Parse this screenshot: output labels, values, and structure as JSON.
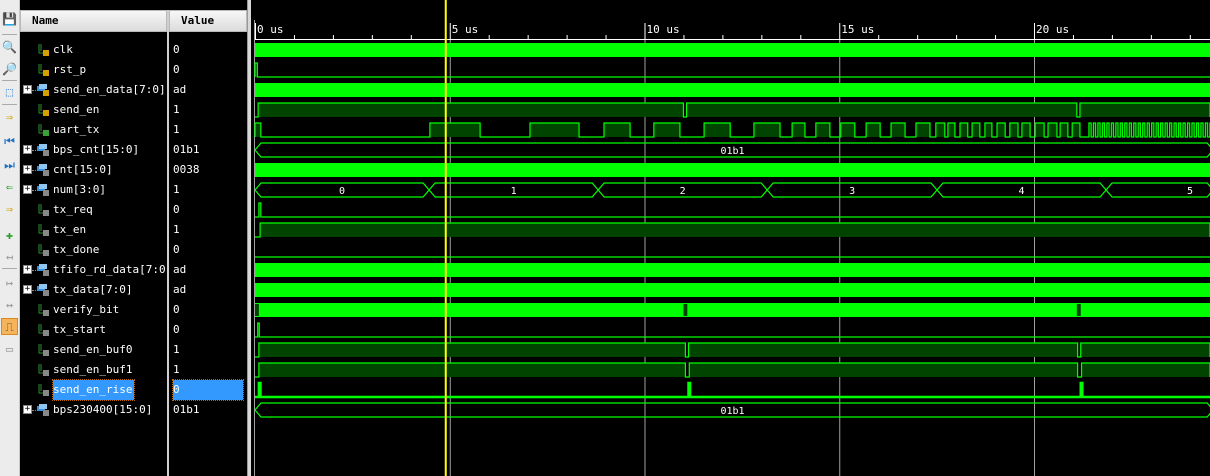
{
  "toolbar": {
    "buttons": [
      {
        "name": "save-icon",
        "glyph": "💾"
      },
      {
        "name": "zoom-in-icon",
        "glyph": "🔍"
      },
      {
        "name": "zoom-out-icon",
        "glyph": "🔎"
      },
      {
        "name": "zoom-fit-icon",
        "glyph": "⬚"
      },
      {
        "name": "goto-cursor-icon",
        "glyph": "⇒"
      },
      {
        "name": "go-to-start-icon",
        "glyph": "⏮"
      },
      {
        "name": "go-to-end-icon",
        "glyph": "⏭"
      },
      {
        "name": "previous-transition-icon",
        "glyph": "⇐"
      },
      {
        "name": "next-transition-icon",
        "glyph": "⇒"
      },
      {
        "name": "add-marker-icon",
        "glyph": "✚"
      },
      {
        "name": "previous-marker-icon",
        "glyph": "↤"
      },
      {
        "name": "next-marker-icon",
        "glyph": "↦"
      },
      {
        "name": "swap-cursors-icon",
        "glyph": "↔"
      },
      {
        "name": "snap-to-transition-icon",
        "glyph": "⎍"
      },
      {
        "name": "ruler-icon",
        "glyph": "▭"
      }
    ]
  },
  "headers": {
    "name": "Name",
    "value": "Value"
  },
  "colors": {
    "wave": "#00ff00",
    "fill": "#004400",
    "cursor": "#ffff00",
    "grid": "#a0a0a0",
    "selection": "#3399ff"
  },
  "timeline": {
    "unit": "us",
    "max_us": 24.6,
    "labels": [
      "0 us",
      "5 us",
      "10 us",
      "15 us",
      "20 us"
    ],
    "label_times": [
      0,
      5,
      10,
      15,
      20
    ],
    "cursor_us": 5.0
  },
  "signals": [
    {
      "name": "clk",
      "value": "0",
      "bus": false,
      "kind": "input",
      "wave": {
        "type": "dense"
      }
    },
    {
      "name": "rst_p",
      "value": "0",
      "bus": false,
      "kind": "input",
      "wave": {
        "type": "bit",
        "high": [
          [
            0,
            0.06
          ]
        ]
      }
    },
    {
      "name": "send_en_data[7:0]",
      "value": "ad",
      "bus": true,
      "kind": "input",
      "wave": {
        "type": "dense"
      }
    },
    {
      "name": "send_en",
      "value": "1",
      "bus": false,
      "kind": "input",
      "wave": {
        "type": "bit",
        "high": [
          [
            0.08,
            11.0
          ],
          [
            11.08,
            21.1
          ],
          [
            21.18,
            24.6
          ]
        ]
      }
    },
    {
      "name": "uart_tx",
      "value": "1",
      "bus": false,
      "kind": "output",
      "wave": {
        "type": "bit",
        "high": [
          [
            0,
            0.15
          ],
          [
            4.49,
            5.78
          ],
          [
            7.06,
            8.32
          ],
          [
            8.96,
            9.63
          ],
          [
            10.24,
            10.91
          ],
          [
            11.53,
            12.2
          ],
          [
            12.81,
            13.48
          ],
          [
            13.79,
            14.12
          ],
          [
            14.4,
            14.76
          ],
          [
            15.04,
            15.4
          ],
          [
            15.69,
            16.05
          ],
          [
            16.33,
            16.69
          ],
          [
            16.97,
            17.33
          ],
          [
            17.48,
            17.71
          ],
          [
            17.79,
            17.97
          ],
          [
            18.1,
            18.3
          ],
          [
            18.41,
            18.61
          ],
          [
            18.74,
            18.92
          ],
          [
            19.05,
            19.26
          ],
          [
            19.38,
            19.59
          ],
          [
            19.69,
            19.9
          ],
          [
            20.03,
            20.26
          ],
          [
            20.36,
            20.59
          ],
          [
            20.67,
            20.87
          ],
          [
            20.98,
            21.18
          ]
        ],
        "toggle_from": 21.41,
        "toggle_period": 0.115
      }
    },
    {
      "name": "bps_cnt[15:0]",
      "value": "01b1",
      "bus": true,
      "kind": "internal",
      "wave": {
        "type": "bus",
        "segments": [
          {
            "from": 0,
            "to": 24.6,
            "label": "01b1"
          }
        ]
      }
    },
    {
      "name": "cnt[15:0]",
      "value": "0038",
      "bus": true,
      "kind": "internal",
      "wave": {
        "type": "dense"
      }
    },
    {
      "name": "num[3:0]",
      "value": "1",
      "bus": true,
      "kind": "internal",
      "wave": {
        "type": "bus",
        "segments": [
          {
            "from": 0,
            "to": 4.47,
            "label": "0"
          },
          {
            "from": 4.47,
            "to": 8.81,
            "label": "1"
          },
          {
            "from": 8.81,
            "to": 13.15,
            "label": "2"
          },
          {
            "from": 13.15,
            "to": 17.51,
            "label": "3"
          },
          {
            "from": 17.51,
            "to": 21.85,
            "label": "4"
          },
          {
            "from": 21.85,
            "to": 24.6,
            "label": "5"
          }
        ]
      }
    },
    {
      "name": "tx_req",
      "value": "0",
      "bus": false,
      "kind": "internal",
      "wave": {
        "type": "bit",
        "high": [
          [
            0.1,
            0.15
          ]
        ]
      }
    },
    {
      "name": "tx_en",
      "value": "1",
      "bus": false,
      "kind": "internal",
      "wave": {
        "type": "bit",
        "high": [
          [
            0.13,
            24.6
          ]
        ]
      }
    },
    {
      "name": "tx_done",
      "value": "0",
      "bus": false,
      "kind": "internal",
      "wave": {
        "type": "bit",
        "high": []
      }
    },
    {
      "name": "tfifo_rd_data[7:0]",
      "value": "ad",
      "bus": true,
      "kind": "internal",
      "wave": {
        "type": "dense"
      }
    },
    {
      "name": "tx_data[7:0]",
      "value": "ad",
      "bus": true,
      "kind": "internal",
      "wave": {
        "type": "dense"
      }
    },
    {
      "name": "verify_bit",
      "value": "0",
      "bus": false,
      "kind": "internal",
      "wave": {
        "type": "dense",
        "gaps": [
          [
            0,
            0.1
          ],
          [
            11.0,
            11.1
          ],
          [
            21.1,
            21.2
          ]
        ]
      }
    },
    {
      "name": "tx_start",
      "value": "0",
      "bus": false,
      "kind": "internal",
      "wave": {
        "type": "bit",
        "high": [
          [
            0.07,
            0.11
          ]
        ]
      }
    },
    {
      "name": "send_en_buf0",
      "value": "1",
      "bus": false,
      "kind": "internal",
      "wave": {
        "type": "bit",
        "high": [
          [
            0.1,
            11.05
          ],
          [
            11.13,
            21.12
          ],
          [
            21.2,
            24.6
          ]
        ]
      }
    },
    {
      "name": "send_en_buf1",
      "value": "1",
      "bus": false,
      "kind": "internal",
      "wave": {
        "type": "bit",
        "high": [
          [
            0.1,
            11.05
          ],
          [
            11.15,
            21.12
          ],
          [
            21.22,
            24.6
          ]
        ]
      }
    },
    {
      "name": "send_en_rise",
      "value": "0",
      "bus": false,
      "kind": "internal",
      "selected": true,
      "wave": {
        "type": "bit",
        "high": [
          [
            0.1,
            0.14
          ],
          [
            11.13,
            11.17
          ],
          [
            21.2,
            21.24
          ]
        ]
      }
    },
    {
      "name": "bps230400[15:0]",
      "value": "01b1",
      "bus": true,
      "kind": "constant",
      "wave": {
        "type": "bus",
        "segments": [
          {
            "from": 0,
            "to": 24.6,
            "label": "01b1"
          }
        ]
      }
    }
  ]
}
